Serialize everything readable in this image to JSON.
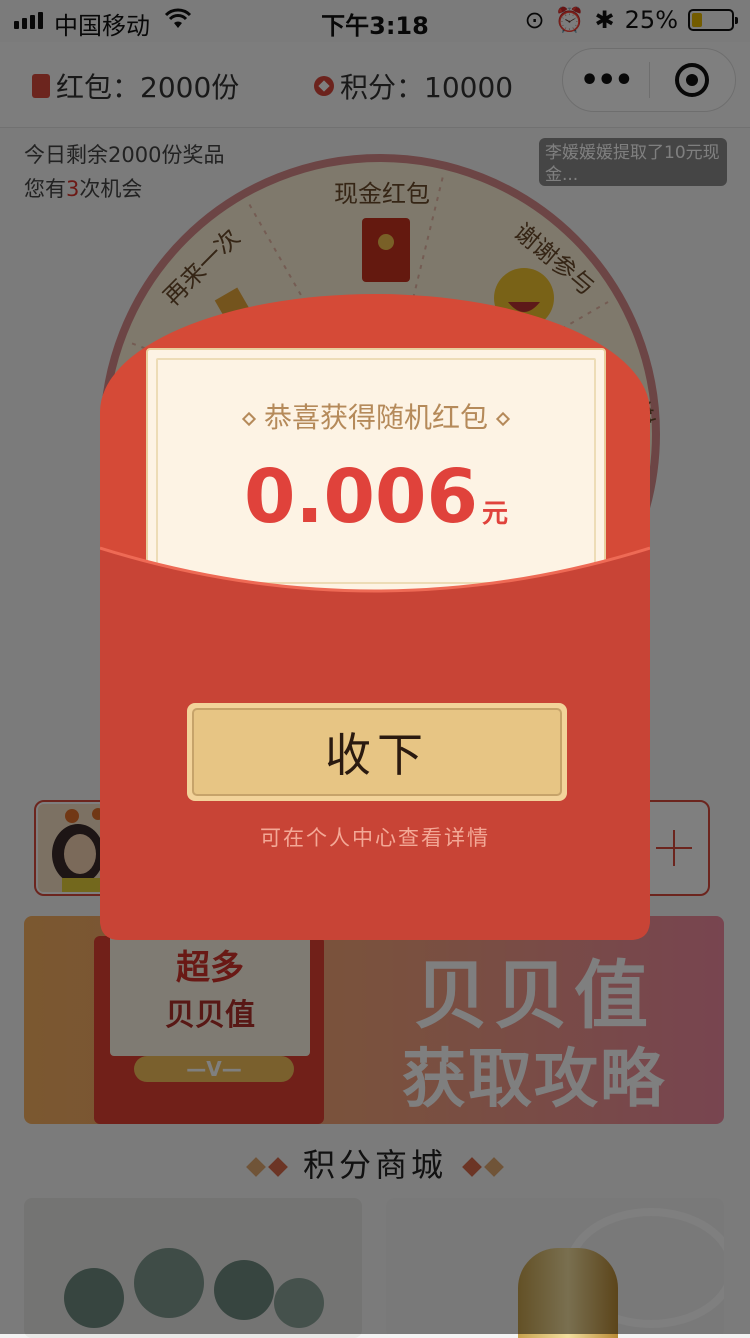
{
  "status_bar": {
    "carrier": "中国移动",
    "time": "下午3:18",
    "battery": "25%",
    "battery_level": 0.25
  },
  "nav": {
    "redpacket_label": "红包：2000份",
    "points_label": "积分：10000"
  },
  "lottery": {
    "remaining_text": "今日剩余2000份奖品",
    "chance_prefix": "您有",
    "chance_count": "3",
    "chance_suffix": "次机会",
    "broadcast": "李媛媛媛提取了10元现金...",
    "wheel_labels": [
      "现金红包",
      "谢谢参与",
      "谢谢",
      "再来一次",
      "参与"
    ]
  },
  "banner": {
    "small_line1": "超多",
    "small_line2": "贝贝值",
    "ribbon": "—V—",
    "big_line1": "贝贝值",
    "big_line2": "获取攻略"
  },
  "mall": {
    "title": "积分商城"
  },
  "modal": {
    "title": "恭喜获得随机红包",
    "amount": "0.006",
    "unit": "元",
    "button_label": "收下",
    "hint": "可在个人中心查看详情"
  },
  "colors": {
    "packet_red": "#d54a37",
    "amount_red": "#e0423b",
    "button_gold": "#e7c584"
  }
}
